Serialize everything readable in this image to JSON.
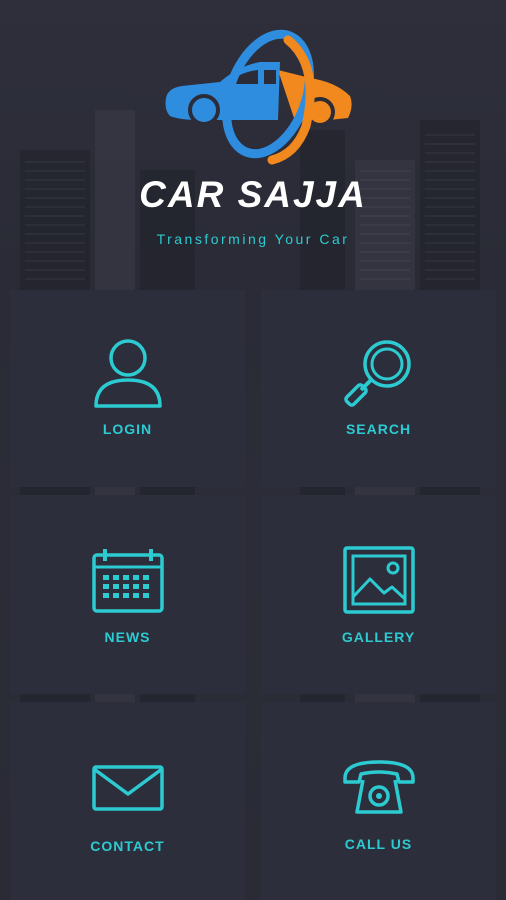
{
  "brand": {
    "name": "CAR SAJJA",
    "tagline": "Transforming Your Car",
    "accent_color": "#2ccbd2",
    "logo_blue": "#2f8de0",
    "logo_orange": "#f2891e"
  },
  "menu": [
    {
      "id": "login",
      "label": "LOGIN",
      "icon": "user-icon"
    },
    {
      "id": "search",
      "label": "SEARCH",
      "icon": "magnifier-icon"
    },
    {
      "id": "news",
      "label": "NEWS",
      "icon": "calendar-icon"
    },
    {
      "id": "gallery",
      "label": "GALLERY",
      "icon": "image-icon"
    },
    {
      "id": "contact",
      "label": "CONTACT",
      "icon": "envelope-icon"
    },
    {
      "id": "call",
      "label": "CALL US",
      "icon": "phone-icon"
    }
  ]
}
